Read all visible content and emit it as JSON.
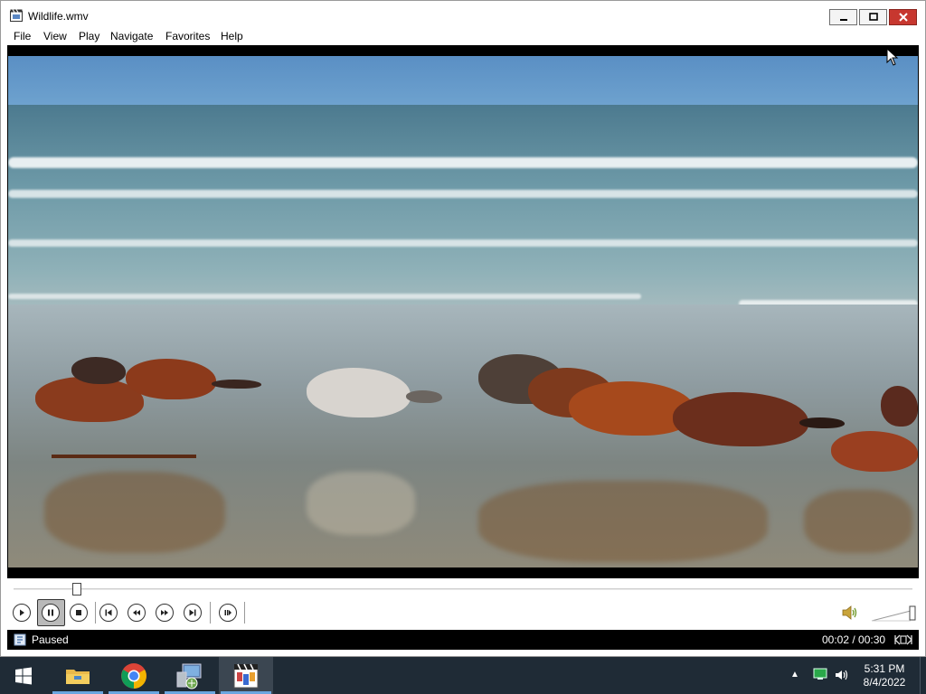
{
  "window": {
    "title": "Wildlife.wmv",
    "controls": {
      "minimize": "minimize",
      "maximize": "maximize",
      "close": "close"
    }
  },
  "menu": {
    "items": [
      {
        "label": "File"
      },
      {
        "label": "View"
      },
      {
        "label": "Play"
      },
      {
        "label": "Navigate"
      },
      {
        "label": "Favorites"
      },
      {
        "label": "Help"
      }
    ]
  },
  "player": {
    "seek_position": 0.07,
    "controls": [
      {
        "name": "play",
        "icon": "play-icon"
      },
      {
        "name": "pause",
        "icon": "pause-icon",
        "pressed": true
      },
      {
        "name": "stop",
        "icon": "stop-icon"
      },
      {
        "name": "previous",
        "icon": "skip-previous-icon"
      },
      {
        "name": "rewind",
        "icon": "rewind-icon"
      },
      {
        "name": "fast-forward",
        "icon": "fast-forward-icon"
      },
      {
        "name": "next",
        "icon": "skip-next-icon"
      },
      {
        "name": "frame-step",
        "icon": "frame-step-icon"
      }
    ],
    "volume_level": 0.9
  },
  "status": {
    "state": "Paused",
    "time": "00:02 / 00:30"
  },
  "taskbar": {
    "items": [
      {
        "name": "file-explorer",
        "icon": "folder-icon"
      },
      {
        "name": "chrome",
        "icon": "chrome-icon"
      },
      {
        "name": "network-app",
        "icon": "network-computer-icon"
      },
      {
        "name": "media-player",
        "icon": "media-player-icon",
        "active": true
      }
    ],
    "clock_time": "5:31 PM",
    "clock_date": "8/4/2022"
  },
  "colors": {
    "titlebar_bg": "#ffffff",
    "close_button": "#c7372f",
    "statusbar_bg": "#000000",
    "taskbar_bg": "#1f2b36",
    "taskbar_accent": "#6aa6e0"
  }
}
